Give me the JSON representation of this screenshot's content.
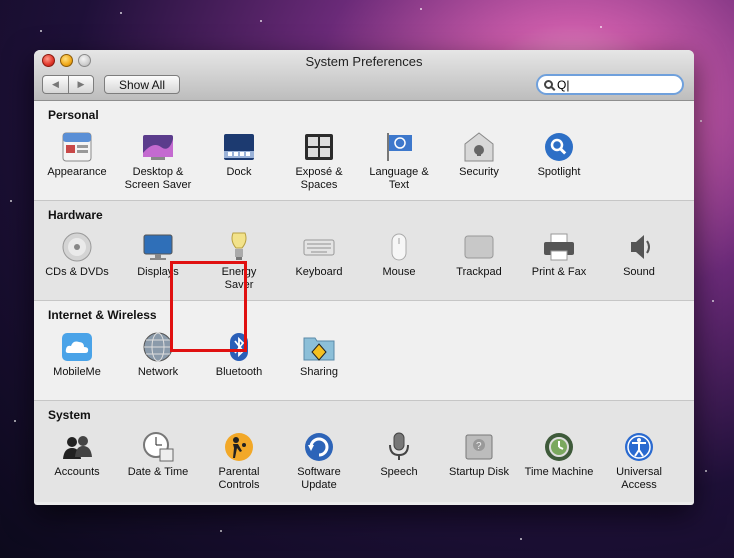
{
  "window": {
    "title": "System Preferences",
    "show_all_label": "Show All",
    "search_value": "Q|"
  },
  "sections": [
    {
      "title": "Personal",
      "items": [
        {
          "label": "Appearance",
          "icon": "appearance-icon"
        },
        {
          "label": "Desktop &\nScreen Saver",
          "icon": "desktop-screensaver-icon"
        },
        {
          "label": "Dock",
          "icon": "dock-icon"
        },
        {
          "label": "Exposé &\nSpaces",
          "icon": "expose-spaces-icon"
        },
        {
          "label": "Language &\nText",
          "icon": "language-text-icon"
        },
        {
          "label": "Security",
          "icon": "security-icon"
        },
        {
          "label": "Spotlight",
          "icon": "spotlight-icon"
        }
      ]
    },
    {
      "title": "Hardware",
      "items": [
        {
          "label": "CDs & DVDs",
          "icon": "cd-dvd-icon"
        },
        {
          "label": "Displays",
          "icon": "displays-icon"
        },
        {
          "label": "Energy\nSaver",
          "icon": "energy-saver-icon"
        },
        {
          "label": "Keyboard",
          "icon": "keyboard-icon"
        },
        {
          "label": "Mouse",
          "icon": "mouse-icon"
        },
        {
          "label": "Trackpad",
          "icon": "trackpad-icon"
        },
        {
          "label": "Print & Fax",
          "icon": "printer-icon"
        },
        {
          "label": "Sound",
          "icon": "speaker-icon"
        }
      ]
    },
    {
      "title": "Internet & Wireless",
      "items": [
        {
          "label": "MobileMe",
          "icon": "mobileme-cloud-icon"
        },
        {
          "label": "Network",
          "icon": "network-globe-icon"
        },
        {
          "label": "Bluetooth",
          "icon": "bluetooth-icon"
        },
        {
          "label": "Sharing",
          "icon": "sharing-folder-icon"
        }
      ]
    },
    {
      "title": "System",
      "items": [
        {
          "label": "Accounts",
          "icon": "accounts-icon"
        },
        {
          "label": "Date & Time",
          "icon": "clock-calendar-icon"
        },
        {
          "label": "Parental\nControls",
          "icon": "parental-controls-icon"
        },
        {
          "label": "Software\nUpdate",
          "icon": "software-update-icon"
        },
        {
          "label": "Speech",
          "icon": "microphone-icon"
        },
        {
          "label": "Startup Disk",
          "icon": "hard-disk-icon"
        },
        {
          "label": "Time Machine",
          "icon": "time-machine-icon"
        },
        {
          "label": "Universal\nAccess",
          "icon": "universal-access-icon"
        }
      ]
    }
  ],
  "colors": {
    "highlight_box": "#e01010",
    "search_focus_ring": "#6fa0dc"
  }
}
